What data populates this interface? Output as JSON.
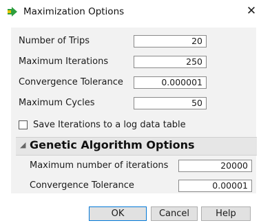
{
  "window": {
    "title": "Maximization Options",
    "close_glyph": "✕",
    "icon": "jmp-arrow-icon"
  },
  "fields": [
    {
      "label": "Number of Trips",
      "value": "20"
    },
    {
      "label": "Maximum Iterations",
      "value": "250"
    },
    {
      "label": "Convergence Tolerance",
      "value": "0.000001"
    },
    {
      "label": "Maximum Cycles",
      "value": "50"
    }
  ],
  "save_iterations": {
    "label": "Save Iterations to a log data table",
    "checked": false
  },
  "genetic": {
    "title": "Genetic Algorithm Options",
    "disclosure_glyph": "◢",
    "fields": [
      {
        "label": "Maximum number of iterations",
        "value": "20000"
      },
      {
        "label": "Convergence Tolerance",
        "value": "0.00001"
      }
    ]
  },
  "buttons": {
    "ok": "OK",
    "cancel": "Cancel",
    "help": "Help"
  },
  "colors": {
    "panel": "#f2f2f2",
    "outline_header": "#e6e6e6",
    "icon_green": "#2e9e3e",
    "icon_yellow": "#e8c400",
    "default_button_border": "#0078d7"
  }
}
